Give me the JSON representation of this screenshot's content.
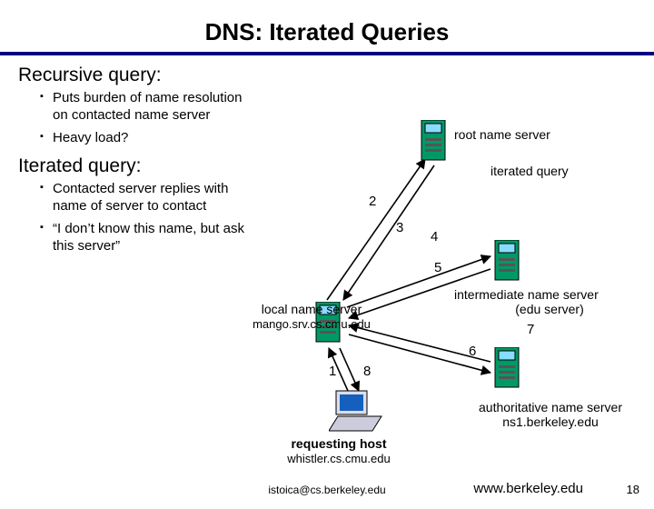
{
  "title": "DNS: Iterated Queries",
  "recursive": {
    "head": "Recursive query:",
    "b1": "Puts burden of name resolution on contacted name server",
    "b2": "Heavy load?"
  },
  "iterated": {
    "head": "Iterated query:",
    "b1": "Contacted server replies with name of server to contact",
    "b2": "“I don’t know this name, but ask this server”"
  },
  "labels": {
    "root": "root name server",
    "iterated_query": "iterated query",
    "intermediate1": "intermediate name server",
    "intermediate2": "(edu server)",
    "authoritative1": "authoritative name server",
    "authoritative2": "ns1.berkeley.edu",
    "local1": "local name server",
    "local2": "mango.srv.cs.cmu.edu",
    "reqhost1": "requesting host",
    "reqhost2": "whistler.cs.cmu.edu"
  },
  "nums": {
    "n1": "1",
    "n2": "2",
    "n3": "3",
    "n4": "4",
    "n5": "5",
    "n6": "6",
    "n7": "7",
    "n8": "8"
  },
  "footer": {
    "email": "istoica@cs.berkeley.edu",
    "right": "www.berkeley.edu",
    "page": "18"
  }
}
